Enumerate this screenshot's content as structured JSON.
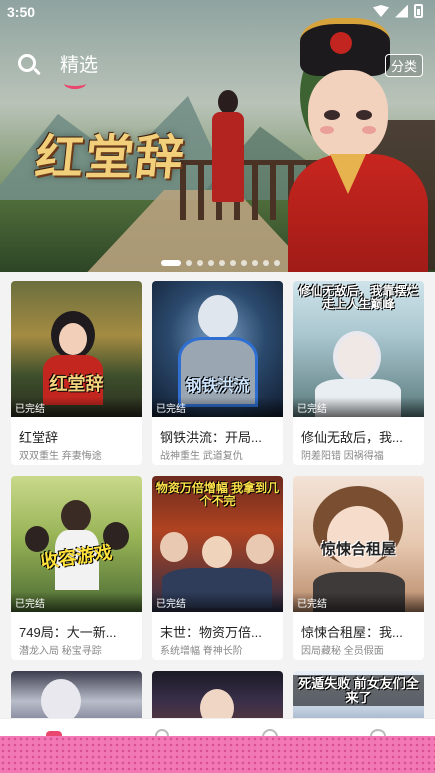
{
  "status_bar": {
    "time": "3:50"
  },
  "header": {
    "tab_featured": "精选",
    "category_button": "分类"
  },
  "banner": {
    "title": "红堂辞",
    "slide_count": 10,
    "active_slide": 1
  },
  "cards": [
    {
      "cover_text": "红堂辞",
      "status": "已完结",
      "name": "红堂辞",
      "tags": "双双重生 弃妻悔途"
    },
    {
      "cover_text": "钢铁洪流",
      "status": "已完结",
      "name": "钢铁洪流：开局...",
      "tags": "战神重生 武道复仇"
    },
    {
      "cover_text": "修仙无敌后，我靠摆烂走上人生巅峰",
      "status": "已完结",
      "name": "修仙无敌后，我...",
      "tags": "阴差阳错 因祸得福"
    },
    {
      "cover_text": "收容游戏",
      "status": "已完结",
      "name": "749局：大一新...",
      "tags": "潜龙入局 秘宝寻踪"
    },
    {
      "cover_text": "物资万倍增幅 我拿到几个不完",
      "status": "已完结",
      "name": "末世：物资万倍...",
      "tags": "系统增幅 脊神长阶"
    },
    {
      "cover_text": "惊悚合租屋",
      "status": "已完结",
      "name": "惊悚合租屋：我...",
      "tags": "因局藏秘 全员假面"
    },
    {
      "cover_text": "",
      "status": "",
      "name": "",
      "tags": ""
    },
    {
      "cover_text": "",
      "status": "",
      "name": "",
      "tags": ""
    },
    {
      "cover_text": "死遁失败 前女友们全来了",
      "status": "",
      "name": "",
      "tags": ""
    }
  ],
  "bottom_nav": {
    "items": [
      "home-icon",
      "favorites-icon",
      "discover-icon",
      "mine-icon"
    ],
    "active": 0
  },
  "colors": {
    "accent": "#e9476d",
    "overlay": "#f178b4"
  }
}
